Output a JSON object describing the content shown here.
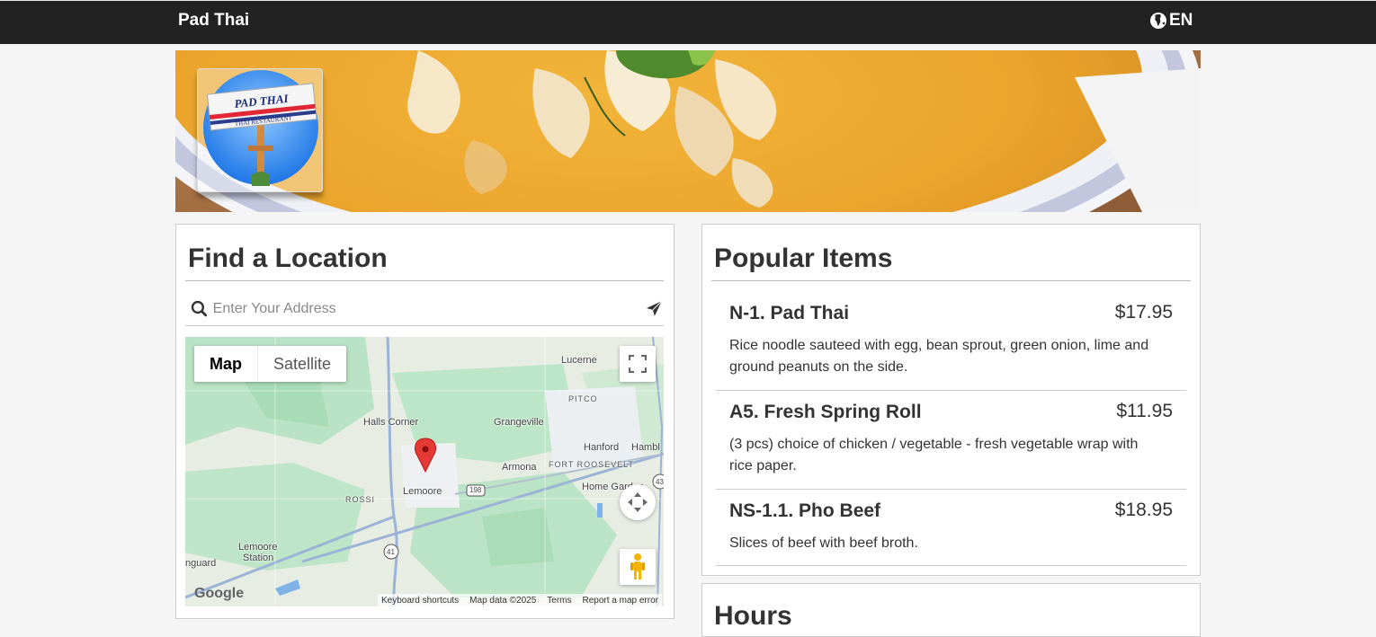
{
  "nav": {
    "brand": "Pad Thai",
    "language": "EN",
    "globe_icon": "globe-icon"
  },
  "logo": {
    "sign_line1": "PAD THAI",
    "sign_line2": "THAI RESTAURANT"
  },
  "location": {
    "title": "Find a Location",
    "search_placeholder": "Enter Your Address",
    "search_icon": "search-icon",
    "submit_icon": "paper-plane-icon"
  },
  "map": {
    "toggle_map": "Map",
    "toggle_satellite": "Satellite",
    "labels": {
      "lucerne": "Lucerne",
      "pitco": "PITCO",
      "halls_corner": "Halls Corner",
      "grangeville": "Grangeville",
      "hanford": "Hanford",
      "hambl": "Hambl",
      "armona": "Armona",
      "fort_roosevelt": "FORT ROOSEVELT",
      "home_garden": "Home Garden",
      "lemoore": "Lemoore",
      "rossi": "ROSSI",
      "lemoore_station_1": "Lemoore",
      "lemoore_station_2": "Station",
      "nguard": "nguard",
      "hwy198": "198",
      "hwy41": "41",
      "hwy43": "43"
    },
    "google": "Google",
    "attribution": {
      "shortcuts": "Keyboard shortcuts",
      "data": "Map data ©2025",
      "terms": "Terms",
      "report": "Report a map error"
    }
  },
  "popular": {
    "title": "Popular Items",
    "items": [
      {
        "name": "N-1. Pad Thai",
        "price": "$17.95",
        "desc_line1": "Rice noodle sauteed with egg, bean sprout, green onion, lime and",
        "desc_line2": "ground peanuts on the side."
      },
      {
        "name": "A5. Fresh Spring Roll",
        "price": "$11.95",
        "desc_line1": "(3 pcs) choice of chicken / vegetable - fresh vegetable wrap with",
        "desc_line2": "rice paper."
      },
      {
        "name": "NS-1.1. Pho Beef",
        "price": "$18.95",
        "desc_line1": "Slices of beef with beef broth.",
        "desc_line2": ""
      }
    ]
  },
  "hours": {
    "title": "Hours"
  }
}
